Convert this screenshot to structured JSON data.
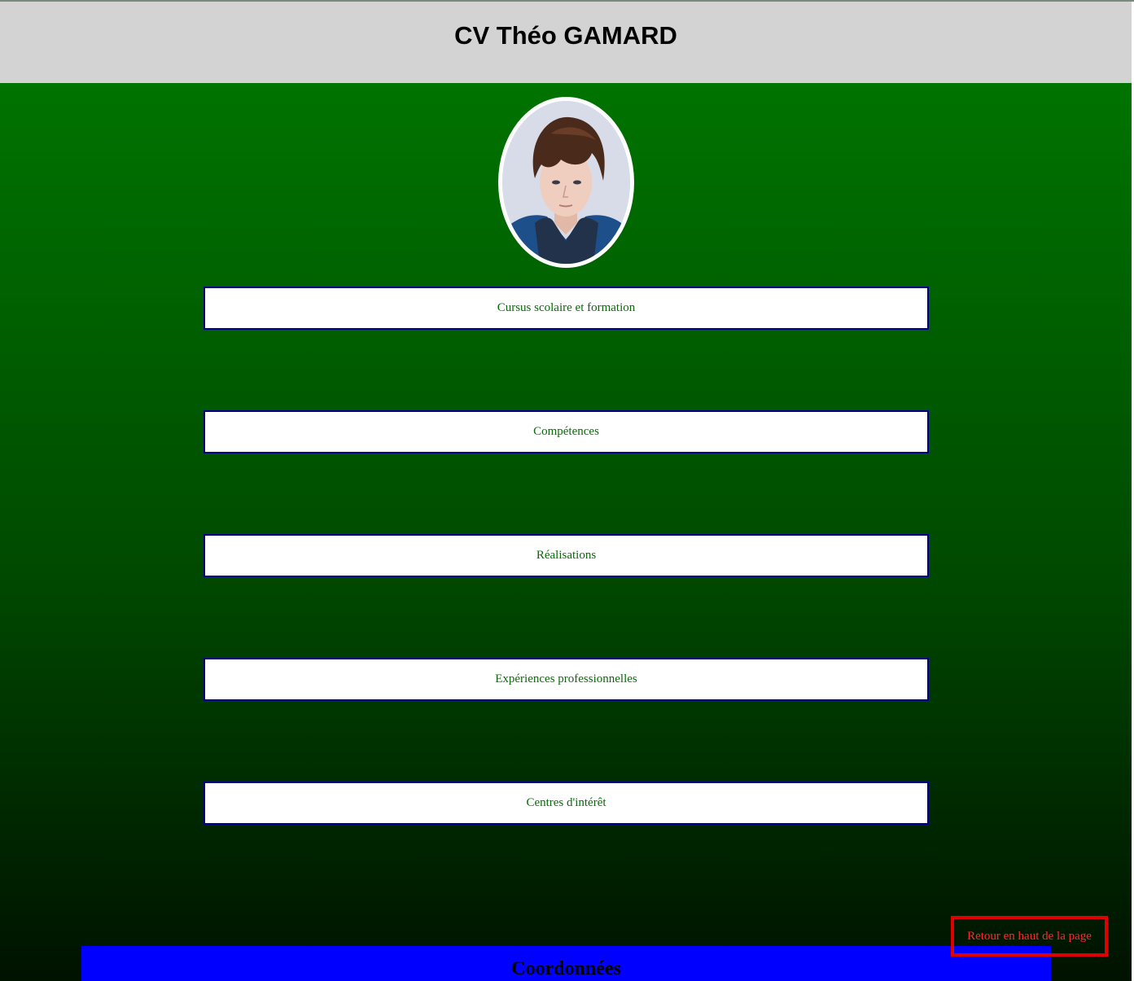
{
  "header": {
    "title": "CV Théo GAMARD"
  },
  "profile": {
    "photo_icon": "portrait-photo"
  },
  "sections": [
    {
      "label": "Cursus scolaire et formation"
    },
    {
      "label": "Compétences"
    },
    {
      "label": "Réalisations"
    },
    {
      "label": "Expériences professionnelles"
    },
    {
      "label": "Centres d'intérêt"
    }
  ],
  "back_to_top": {
    "label": "Retour en haut de la page"
  },
  "contact": {
    "title": "Coordonnées"
  },
  "colors": {
    "header_bg": "#d3d3d3",
    "background_top": "#007300",
    "background_bottom": "#001200",
    "section_text": "#0a6a0a",
    "section_border": "#00008b",
    "back_to_top": "#ff2a2a",
    "contact_bg": "#0000ff"
  }
}
